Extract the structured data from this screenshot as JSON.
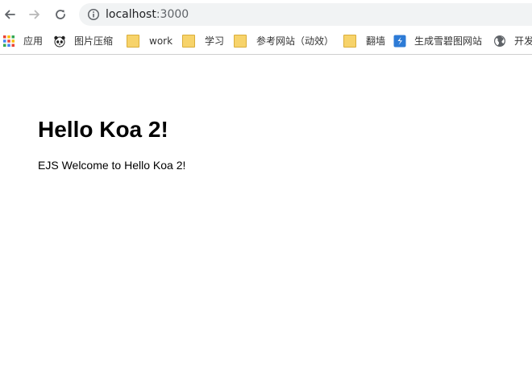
{
  "browser": {
    "url_host": "localhost",
    "url_port": ":3000"
  },
  "bookmarks": [
    {
      "label": "应用",
      "icon": "apps-grid-icon"
    },
    {
      "label": "图片压缩",
      "icon": "panda-icon"
    },
    {
      "label": "work",
      "icon": "folder-icon"
    },
    {
      "label": "学习",
      "icon": "folder-icon"
    },
    {
      "label": "参考网站（动效）",
      "icon": "folder-icon"
    },
    {
      "label": "翻墙",
      "icon": "folder-icon"
    },
    {
      "label": "生成雪碧图网站",
      "icon": "sprite-logo-icon"
    },
    {
      "label": "开发",
      "icon": "globe-icon"
    }
  ],
  "page": {
    "heading": "Hello Koa 2!",
    "paragraph": "EJS Welcome to Hello Koa 2!"
  },
  "colors": {
    "omnibox_bg": "#f1f3f4",
    "folder": "#f7d36a",
    "sprite_logo": "#2d7bd6"
  }
}
